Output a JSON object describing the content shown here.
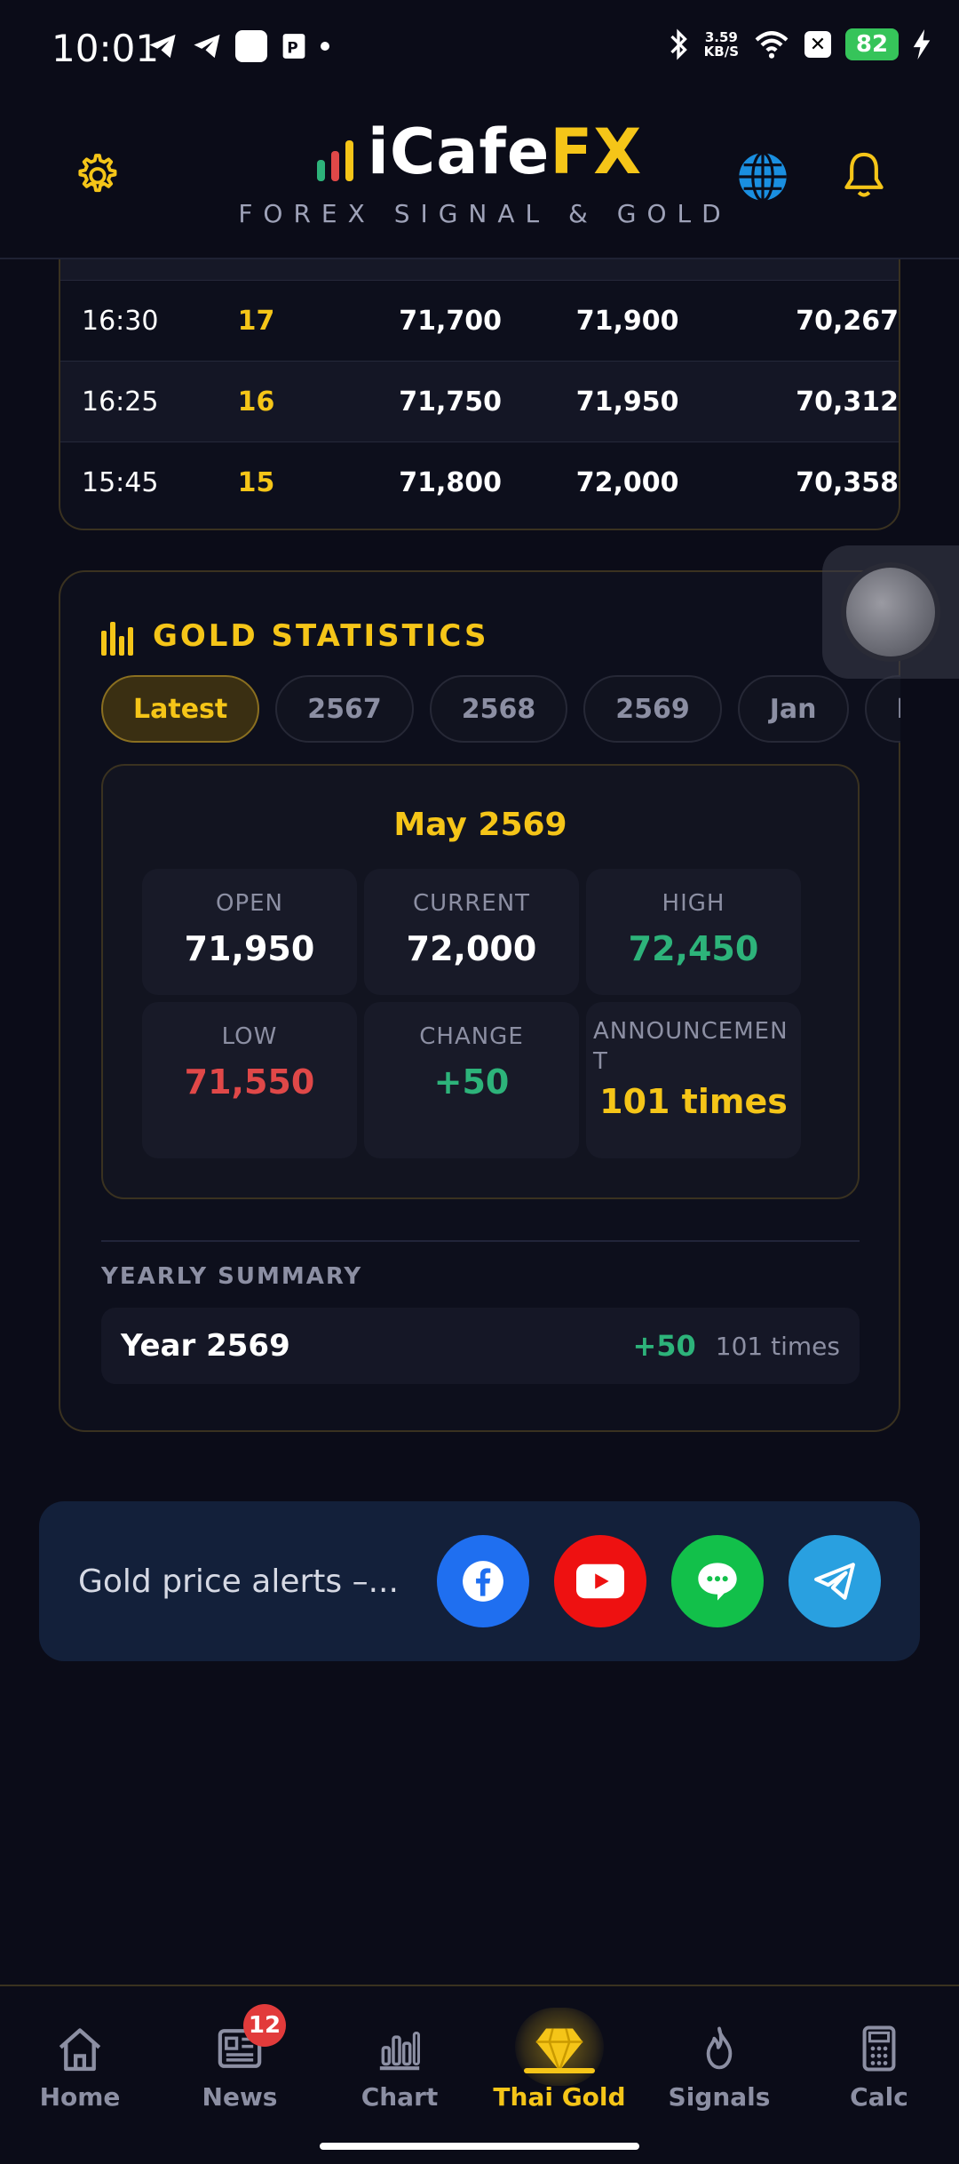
{
  "status_bar": {
    "time": "10:01",
    "net_speed_value": "3.59",
    "net_speed_unit": "KB/S",
    "battery_level": "82"
  },
  "header": {
    "logo_part1": "iCafe",
    "logo_part2": "FX",
    "tagline": "FOREX SIGNAL & GOLD"
  },
  "price_table": {
    "rows": [
      {
        "time": "16:30",
        "round": "17",
        "buy": "71,700",
        "sell": "71,900",
        "price3": "70,267"
      },
      {
        "time": "16:25",
        "round": "16",
        "buy": "71,750",
        "sell": "71,950",
        "price3": "70,312"
      },
      {
        "time": "15:45",
        "round": "15",
        "buy": "71,800",
        "sell": "72,000",
        "price3": "70,358"
      }
    ]
  },
  "gold_statistics": {
    "title": "GOLD STATISTICS",
    "tabs": [
      "Latest",
      "2567",
      "2568",
      "2569",
      "Jan",
      "Feb"
    ],
    "active_tab": "Latest",
    "month_title": "May 2569",
    "stats": {
      "open_label": "OPEN",
      "open_value": "71,950",
      "current_label": "CURRENT",
      "current_value": "72,000",
      "high_label": "HIGH",
      "high_value": "72,450",
      "low_label": "LOW",
      "low_value": "71,550",
      "change_label": "CHANGE",
      "change_value": "+50",
      "announcement_label": "ANNOUNCEMEN T",
      "announcement_value": "101 times"
    },
    "yearly_summary_label": "YEARLY SUMMARY",
    "yearly": {
      "name": "Year 2569",
      "change": "+50",
      "count": "101 times"
    }
  },
  "social_banner": {
    "text": "Gold price alerts –...",
    "buttons": [
      "facebook-icon",
      "youtube-icon",
      "line-chat-icon",
      "telegram-icon"
    ],
    "colors": {
      "facebook": "#1f6ff0",
      "youtube": "#ee1111",
      "line": "#12c04a",
      "telegram": "#29a0e0"
    }
  },
  "bottom_nav": {
    "items": [
      {
        "label": "Home",
        "icon": "home-icon"
      },
      {
        "label": "News",
        "icon": "news-icon",
        "badge": "12"
      },
      {
        "label": "Chart",
        "icon": "chart-icon"
      },
      {
        "label": "Thai Gold",
        "icon": "diamond-icon"
      },
      {
        "label": "Signals",
        "icon": "flame-icon"
      },
      {
        "label": "Calc",
        "icon": "calculator-icon"
      }
    ],
    "active": "Thai Gold"
  },
  "colors": {
    "background": "#0b0c18",
    "accent_gold": "#f5c518",
    "positive": "#2db37a",
    "negative": "#e04848"
  }
}
